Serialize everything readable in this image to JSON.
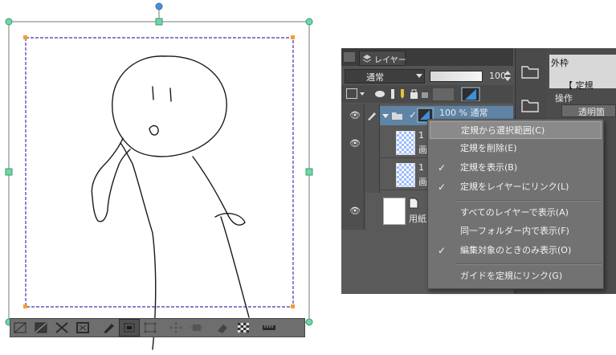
{
  "layer_panel": {
    "tab_label": "レイヤー",
    "blend_mode": "通常",
    "opacity_value": "100",
    "rows": [
      {
        "info": "100 % 通常"
      },
      {
        "name": "1",
        "sub": "画"
      },
      {
        "name": "1",
        "sub": "画"
      },
      {
        "name": "用紙"
      }
    ]
  },
  "right_panel": {
    "outer_frame_label": "外枠",
    "teiki_label": "【 定規",
    "operation_label": "操作",
    "transparent_label": "透明箇"
  },
  "context_menu": {
    "items": [
      {
        "label": "定規から選択範囲(C)",
        "checked": false,
        "highlighted": true
      },
      {
        "label": "定規を削除(E)",
        "checked": false
      },
      {
        "label": "定規を表示(B)",
        "checked": true
      },
      {
        "label": "定規をレイヤーにリンク(L)",
        "checked": true
      },
      {
        "label": "すべてのレイヤーで表示(A)",
        "checked": false
      },
      {
        "label": "同一フォルダー内で表示(F)",
        "checked": false
      },
      {
        "label": "編集対象のときのみ表示(O)",
        "checked": true
      },
      {
        "label": "ガイドを定規にリンク(G)",
        "checked": false
      }
    ],
    "check_glyph": "✓"
  },
  "canvas_toolbar": {
    "icons": [
      "hide-frame-icon",
      "fill-frame-icon",
      "shrink-frame-icon",
      "fit-frame-icon",
      "pen-ruler-icon",
      "select-frame-icon",
      "perspective-frame-icon",
      "dots-icon",
      "scale-icon",
      "eraser-icon",
      "checker-icon",
      "ruler-icon"
    ]
  }
}
